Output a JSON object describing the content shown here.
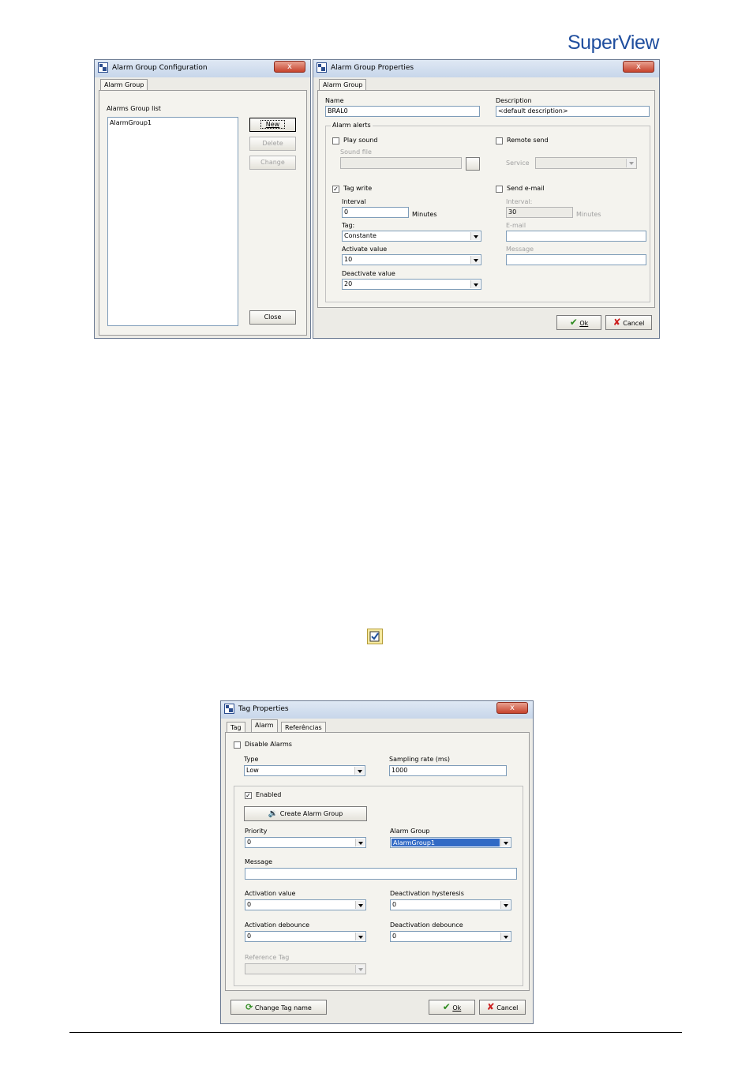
{
  "header": {
    "logo": "SuperView"
  },
  "alarm_group_config": {
    "title": "Alarm Group Configuration",
    "close_x": "x",
    "tab": "Alarm Group",
    "list_label": "Alarms Group list",
    "list_items": [
      "AlarmGroup1"
    ],
    "new_label": "New",
    "delete_label": "Delete",
    "change_label": "Change",
    "close_label": "Close"
  },
  "alarm_group_props": {
    "title": "Alarm Group Properties",
    "close_x": "x",
    "tab": "Alarm Group",
    "name_label": "Name",
    "name_value": "BRAL0",
    "description_label": "Description",
    "description_value": "<default description>",
    "alerts_group": "Alarm alerts",
    "play_sound": "Play sound",
    "sound_file": "Sound file",
    "remote_send": "Remote send",
    "service": "Service",
    "tag_write": "Tag write",
    "tag_write_checked": "✓",
    "interval_label": "Interval",
    "interval_value": "0",
    "minutes": "Minutes",
    "tag_label": "Tag:",
    "tag_value": "Constante",
    "activate_label": "Activate value",
    "activate_value": "10",
    "deactivate_label": "Deactivate value",
    "deactivate_value": "20",
    "send_email": "Send e-mail",
    "email_interval_label": "Interval:",
    "email_interval_value": "30",
    "email_minutes": "Minutes",
    "email_label": "E-mail",
    "message_label": "Message",
    "ok_label": "Ok",
    "cancel_label": "Cancel"
  },
  "tag_props": {
    "title": "Tag Properties",
    "close_x": "x",
    "tabs": [
      "Tag",
      "Alarm",
      "Referências"
    ],
    "disable_alarms": "Disable Alarms",
    "type_label": "Type",
    "type_value": "Low",
    "sampling_label": "Sampling rate (ms)",
    "sampling_value": "1000",
    "enabled": "Enabled",
    "enabled_checked": "✓",
    "create_alarm_group": "Create Alarm Group",
    "priority_label": "Priority",
    "priority_value": "0",
    "alarm_group_label": "Alarm Group",
    "alarm_group_value": "AlarmGroup1",
    "message_label": "Message",
    "activation_value_label": "Activation value",
    "activation_value": "0",
    "deactivation_hysteresis_label": "Deactivation hysteresis",
    "deactivation_hysteresis": "0",
    "activation_debounce_label": "Activation debounce",
    "activation_debounce": "0",
    "deactivation_debounce_label": "Deactivation debounce",
    "deactivation_debounce": "0",
    "reference_tag_label": "Reference Tag",
    "change_tag_name": "Change Tag name",
    "ok_label": "Ok",
    "cancel_label": "Cancel"
  },
  "colors": {
    "logo": "#1f4e9e",
    "selection": "#316ac5",
    "ok_check": "#2e8b1f",
    "cancel_x": "#cc1f1f"
  }
}
